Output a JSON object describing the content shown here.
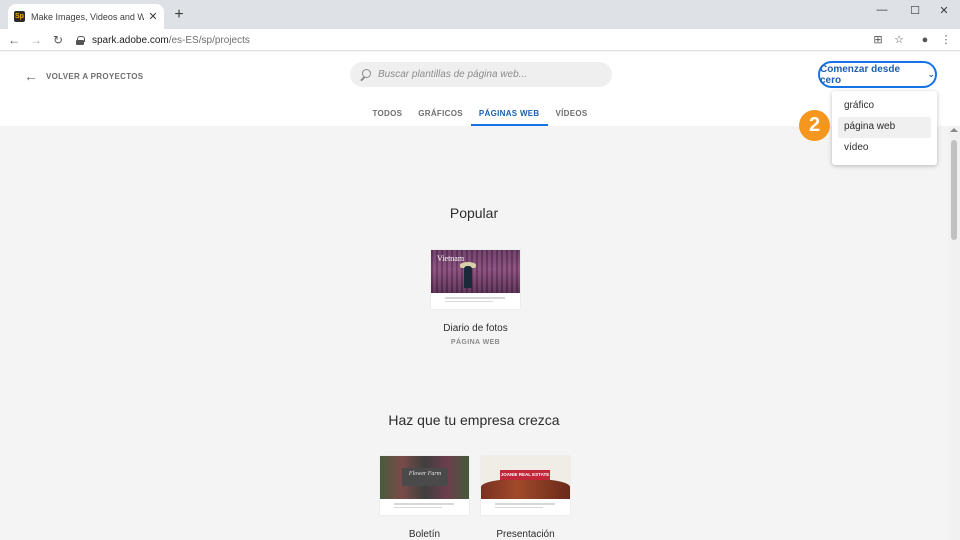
{
  "browser": {
    "tab_title": "Make Images, Videos and Web S",
    "tab_favicon_text": "Sp",
    "url_host": "spark.adobe.com",
    "url_path": "/es-ES/sp/projects",
    "icons": [
      "back-icon",
      "forward-icon",
      "reload-icon",
      "lock-icon",
      "translate-icon",
      "star-icon",
      "account-icon",
      "menu-icon"
    ]
  },
  "header": {
    "back_label": "VOLVER A PROYECTOS",
    "search_placeholder": "Buscar plantillas de página web...",
    "cta_label": "Comenzar desde cero"
  },
  "tabs": [
    {
      "label": "TODOS",
      "active": false
    },
    {
      "label": "GRÁFICOS",
      "active": false
    },
    {
      "label": "PÁGINAS WEB",
      "active": true
    },
    {
      "label": "VÍDEOS",
      "active": false
    }
  ],
  "sections": {
    "popular": {
      "title": "Popular",
      "cards": [
        {
          "name": "Diario de fotos",
          "type": "PÁGINA WEB",
          "thumb_text": "Vietnam"
        }
      ]
    },
    "business": {
      "title": "Haz que tu empresa crezca",
      "cards": [
        {
          "name": "Boletín",
          "thumb_text": "Flower Farm"
        },
        {
          "name": "Presentación",
          "thumb_text": "JOANIE REAL ESTATE"
        }
      ]
    }
  },
  "dropdown": {
    "items": [
      {
        "label": "gráfico",
        "hover": false
      },
      {
        "label": "página web",
        "hover": true
      },
      {
        "label": "vídeo",
        "hover": false
      }
    ]
  },
  "annotation": {
    "step": "2",
    "color": "#f5961e"
  },
  "colors": {
    "accent": "#1473e6",
    "accent_text": "#1c5fb0"
  }
}
